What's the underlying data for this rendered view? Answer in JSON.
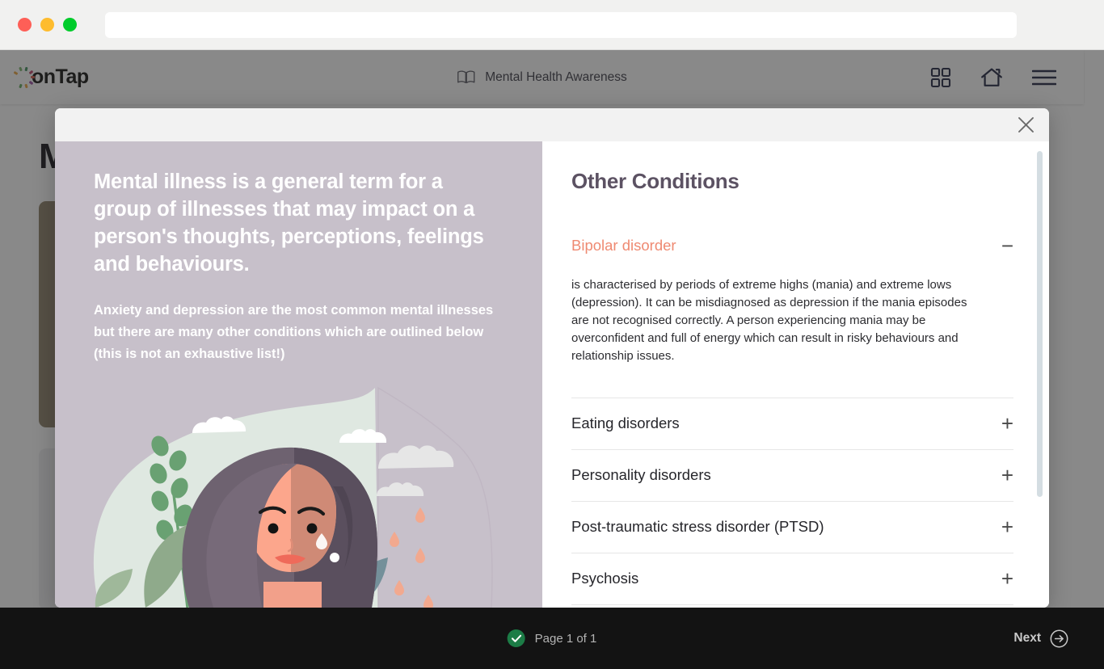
{
  "browser": {
    "url_value": "",
    "url_placeholder": "",
    "traffic_lights": [
      "close",
      "minimize",
      "maximize"
    ]
  },
  "app_header": {
    "brand": "onTap",
    "brand_burst_colors": [
      "#e8a33d",
      "#7bb36a",
      "#3f8f5c",
      "#c0446b",
      "#d85a4a",
      "#9a4fa3",
      "#e8a33d",
      "#5fa85c"
    ],
    "course_title": "Mental Health Awareness",
    "book_icon": "book-icon",
    "actions": [
      {
        "name": "grid-icon",
        "label": "Dashboard"
      },
      {
        "name": "home-icon",
        "label": "Home"
      },
      {
        "name": "hamburger-menu-icon",
        "label": "Menu"
      }
    ]
  },
  "page": {
    "title": "M"
  },
  "modal": {
    "close_label": "Close",
    "intro": {
      "heading": "Mental illness is a general term for a group of illnesses that may impact on a person's thoughts, perceptions, feelings and behaviours.",
      "subtext": "Anxiety and depression are the most common mental illnesses but there are many other conditions which are outlined below (this is not an exhaustive list!)",
      "panel_color": "#c7c0ca",
      "illustration": "woman-with-clouds-and-plants-illustration"
    },
    "conditions": {
      "title": "Other Conditions",
      "accent_color": "#ef8a72",
      "items": [
        {
          "label": "Bipolar disorder",
          "open": true,
          "sign": "−",
          "body": "is characterised by periods of extreme highs (mania) and extreme lows (depression). It can be misdiagnosed as depression if the mania episodes are not recognised correctly. A person experiencing mania may be overconfident and full of energy which can result in risky behaviours and relationship issues."
        },
        {
          "label": "Eating disorders",
          "open": false,
          "sign": "+",
          "body": ""
        },
        {
          "label": "Personality disorders",
          "open": false,
          "sign": "+",
          "body": ""
        },
        {
          "label": "Post-traumatic stress disorder (PTSD)",
          "open": false,
          "sign": "+",
          "body": ""
        },
        {
          "label": "Psychosis",
          "open": false,
          "sign": "+",
          "body": ""
        }
      ]
    }
  },
  "bottom_bar": {
    "status_text": "Page 1 of 1",
    "status_icon": "check-circle-icon",
    "status_icon_color": "#1c7c46",
    "next_label": "Next",
    "next_icon": "arrow-right-circle-icon"
  }
}
